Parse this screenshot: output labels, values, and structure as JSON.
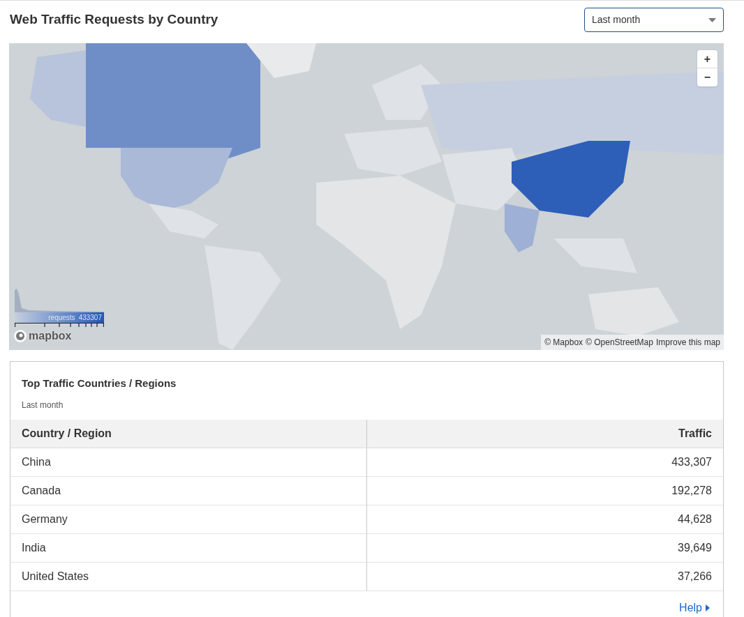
{
  "header": {
    "title": "Web Traffic Requests by Country",
    "range_select": {
      "value": "Last month"
    }
  },
  "map": {
    "zoom_controls": [
      "+",
      "−"
    ],
    "legend": {
      "label": "requests",
      "max": "433307"
    },
    "logo": "mapbox",
    "attribution": [
      "© Mapbox",
      "© OpenStreetMap",
      "Improve this map"
    ]
  },
  "card": {
    "title": "Top Traffic Countries / Regions",
    "subtitle": "Last month",
    "table": {
      "columns": [
        "Country / Region",
        "Traffic"
      ],
      "rows": [
        [
          "China",
          "433,307"
        ],
        [
          "Canada",
          "192,278"
        ],
        [
          "Germany",
          "44,628"
        ],
        [
          "India",
          "39,649"
        ],
        [
          "United States",
          "37,266"
        ]
      ]
    },
    "help_link": "Help"
  }
}
